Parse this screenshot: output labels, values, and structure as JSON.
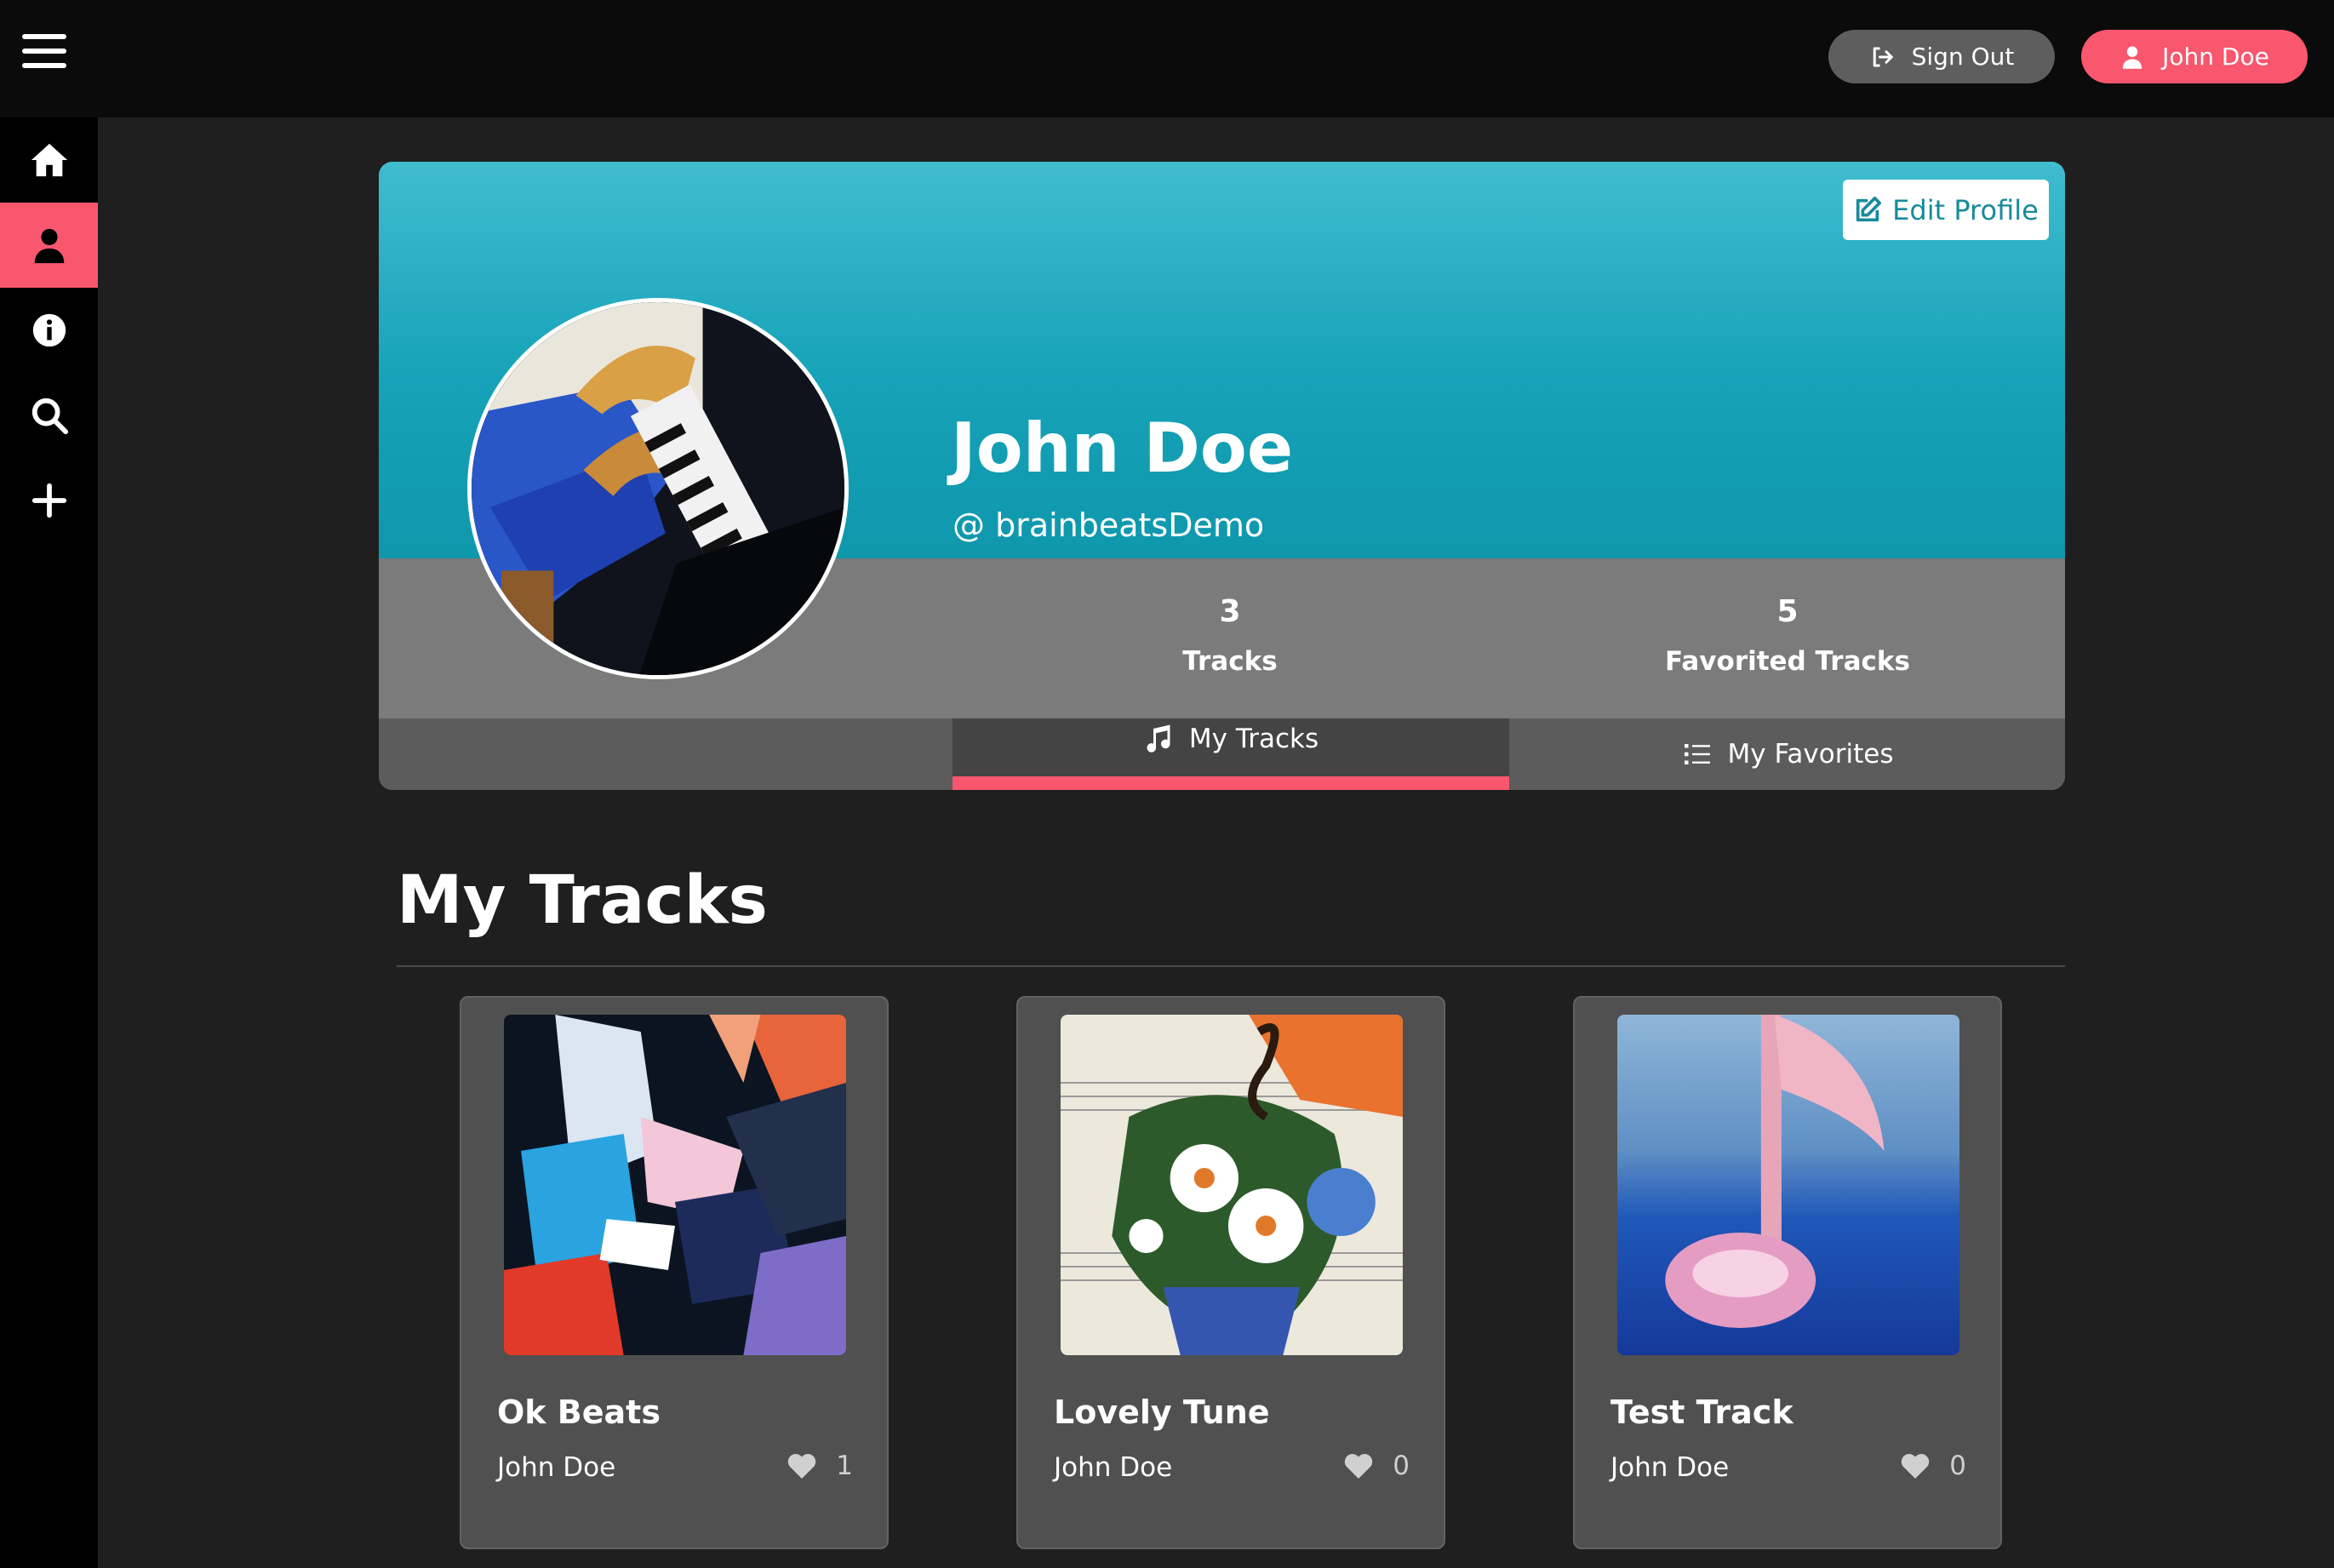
{
  "header": {
    "sign_out_label": "Sign Out",
    "user_label": "John Doe"
  },
  "sidebar": {
    "items": [
      {
        "icon": "home-icon"
      },
      {
        "icon": "user-icon",
        "active": true
      },
      {
        "icon": "info-icon"
      },
      {
        "icon": "search-icon"
      },
      {
        "icon": "plus-icon"
      }
    ]
  },
  "profile": {
    "edit_label": "Edit Profile",
    "name": "John Doe",
    "handle": "@ brainbeatsDemo",
    "stats": {
      "tracks_count": "3",
      "tracks_label": "Tracks",
      "favorites_count": "5",
      "favorites_label": "Favorited Tracks"
    },
    "tabs": {
      "my_tracks": "My Tracks",
      "my_favorites": "My Favorites"
    }
  },
  "section": {
    "title": "My Tracks"
  },
  "tracks": [
    {
      "title": "Ok Beats",
      "artist": "John Doe",
      "likes": "1"
    },
    {
      "title": "Lovely Tune",
      "artist": "John Doe",
      "likes": "0"
    },
    {
      "title": "Test Track",
      "artist": "John Doe",
      "likes": "0"
    }
  ],
  "colors": {
    "accent": "#f8576e",
    "banner": "#16a2b8",
    "background": "#1f1f1f",
    "sidebar": "#000000",
    "topbar": "#0b0b0b"
  }
}
